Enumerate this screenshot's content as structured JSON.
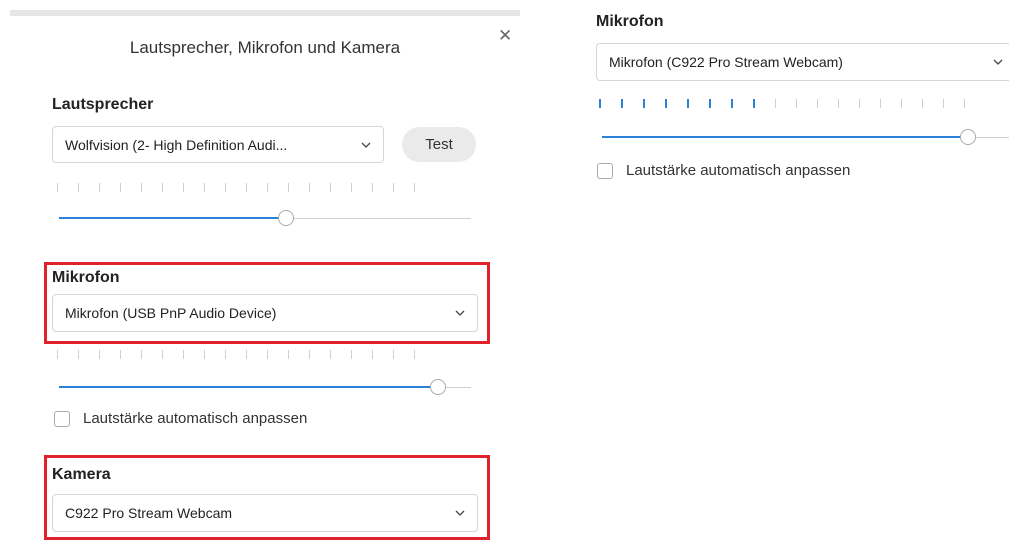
{
  "dialog": {
    "title": "Lautsprecher, Mikrofon und Kamera",
    "close_icon": "close-icon"
  },
  "speaker": {
    "label": "Lautsprecher",
    "selected": "Wolfvision (2- High Definition Audi...",
    "test_label": "Test",
    "level_active_ticks": 0,
    "volume": 0.55
  },
  "microphone": {
    "label": "Mikrofon",
    "selected": "Mikrofon (USB PnP Audio Device)",
    "level_active_ticks": 0,
    "volume": 0.92,
    "auto_adjust_label": "Lautstärke automatisch anpassen",
    "auto_adjust_checked": false
  },
  "camera": {
    "label": "Kamera",
    "selected": "C922 Pro Stream Webcam"
  },
  "zoomed_microphone": {
    "label": "Mikrofon",
    "selected": "Mikrofon (C922 Pro Stream Webcam)",
    "level_active_ticks": 8,
    "volume": 0.9,
    "auto_adjust_label": "Lautstärke automatisch anpassen",
    "auto_adjust_checked": false
  },
  "colors": {
    "accent": "#2a82d8",
    "highlight": "#e0222a"
  }
}
